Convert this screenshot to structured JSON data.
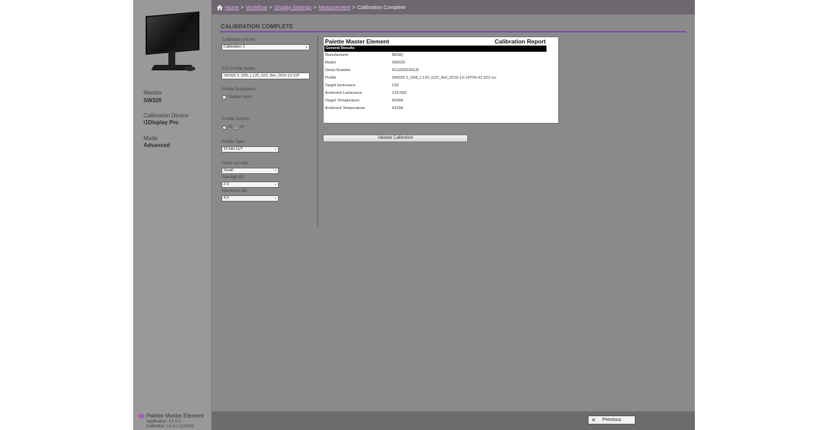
{
  "breadcrumb": {
    "items": [
      {
        "label": "Home",
        "link": true
      },
      {
        "label": "Workflow",
        "link": true
      },
      {
        "label": "Display Settings",
        "link": true
      },
      {
        "label": "Measurement",
        "link": true
      },
      {
        "label": "Calibration Complete",
        "link": false
      }
    ],
    "separator": ">"
  },
  "sidebar": {
    "monitor_label": "Monitor",
    "monitor_value": "SW320",
    "device_label": "Calibration Device",
    "device_value": "i1Display Pro",
    "mode_label": "Mode",
    "mode_value": "Advanced",
    "app_name": "Palette Master Element",
    "app_version": "Application: V1.0.2",
    "calib_version": "Calibrator: V1.3.1 (12143)"
  },
  "section_title": "CALIBRATION COMPLETE",
  "settings": {
    "preset_label": "Calibration preset:",
    "preset_value": "Calibration 1",
    "icc_label": "ICC Profile Name:",
    "icc_value": "SW320 2_D65_L120_G22_Rel_2016-12-19T",
    "distribution_label": "Profile Distribution:",
    "system_level_label": "System level",
    "version_label": "Profile Version:",
    "version_v2": "v2",
    "version_v4": "v4",
    "type_label": "Profile Type:",
    "type_value": "16 bits LUT",
    "patch_label": "Patch set size:",
    "patch_value": "Small",
    "avg_label": "Average ΔE:",
    "avg_value": "2.0",
    "max_label": "Maximum ΔE:",
    "max_value": "4.0"
  },
  "report": {
    "title": "Palette Master Element",
    "subtitle": "Calibration Report",
    "section": "General Results",
    "rows": [
      {
        "key": "Manufacturer",
        "value": "BENQ"
      },
      {
        "key": "Model",
        "value": "SW320"
      },
      {
        "key": "Serial Number",
        "value": "6CG09203SU0"
      },
      {
        "key": "Profile",
        "value": "SW320 2_D65_L120_G22_Rel_2016-12-19T06-41.52Z.icc"
      },
      {
        "key": "Target luminance",
        "value": "120"
      },
      {
        "key": "Achieved Luminance",
        "value": "123.065"
      },
      {
        "key": "Target Temperature",
        "value": "6505K"
      },
      {
        "key": "Achieved Temperature",
        "value": "6415K"
      }
    ]
  },
  "validate_label": "Validate Calibration",
  "previous_label": "Previous",
  "colors": {
    "accent": "#7d4aa6",
    "link": "#d9b3ee",
    "topbar": "#6f676f",
    "content_bg": "#8a8a8a"
  }
}
